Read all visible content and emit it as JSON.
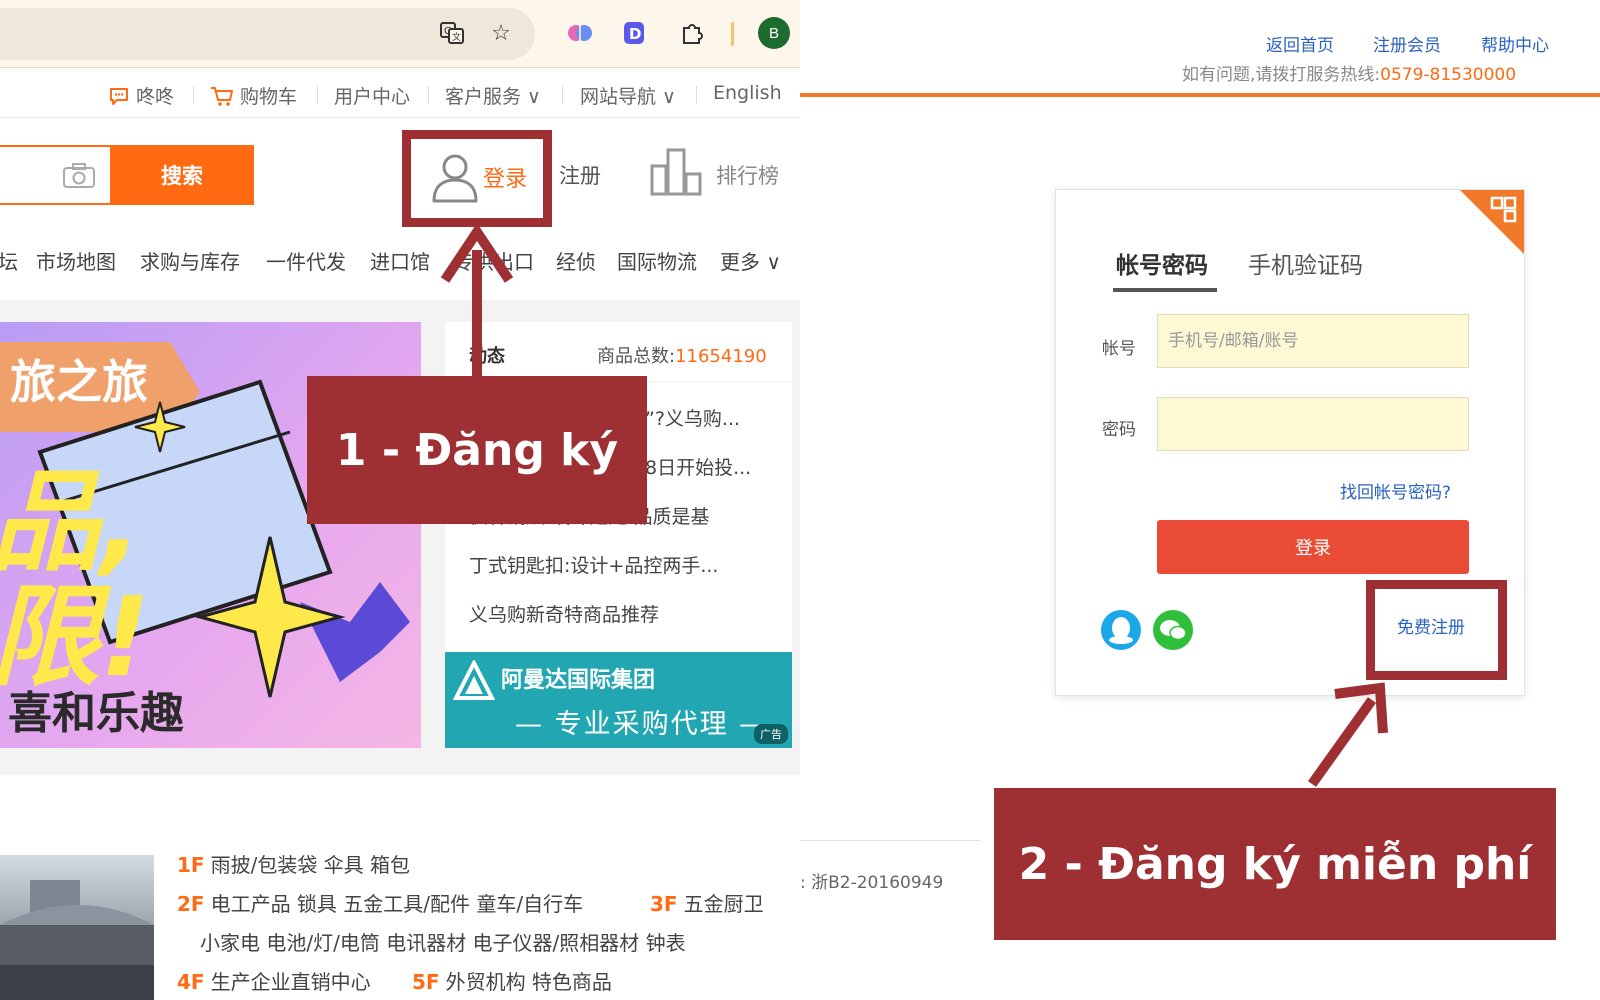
{
  "browser": {
    "avatar_letter": "B"
  },
  "topnav": {
    "items": [
      {
        "label": "咚咚",
        "icon": "chat-bubble-icon"
      },
      {
        "label": "购物车",
        "icon": "cart-icon"
      },
      {
        "label": "用户中心"
      },
      {
        "label": "客户服务 ∨"
      },
      {
        "label": "网站导航 ∨"
      },
      {
        "label": "English"
      }
    ]
  },
  "search": {
    "button_label": "搜索"
  },
  "header_links": {
    "login": "登录",
    "register": "注册",
    "ranking": "排行榜"
  },
  "catnav": {
    "items": [
      "坛",
      "市场地图",
      "求购与库存",
      "一件代发",
      "进口馆",
      "专供出口",
      "经侦",
      "国际物流",
      "更多 ∨"
    ]
  },
  "banner": {
    "line1": "旅之旅",
    "line2": "品,",
    "line3": "限!",
    "footer": "喜和乐趣"
  },
  "news": {
    "title": "动态",
    "goods_label": "商品总数:",
    "goods_count": "11654190",
    "items": [
      "”?义乌购...",
      "8日开始投...",
      "枫林铜烛:设计是定 品质是基",
      "丁式钥匙扣:设计+品控两手...",
      "义乌购新奇特商品推荐"
    ]
  },
  "ad": {
    "company": "阿曼达国际集团",
    "slogan": "— 专业采购代理 —",
    "tag": "广告"
  },
  "floors": {
    "rows": [
      {
        "items": [
          {
            "num": "1F",
            "text": "雨披/包装袋 伞具 箱包"
          }
        ]
      },
      {
        "items": [
          {
            "num": "2F",
            "text": "电工产品 锁具 五金工具/配件 童车/自行车"
          },
          {
            "num": "3F",
            "text": "五金厨卫"
          }
        ]
      },
      {
        "items": [
          {
            "num": "",
            "text": "小家电 电池/灯/电筒 电讯器材 电子仪器/照相器材 钟表"
          }
        ]
      },
      {
        "items": [
          {
            "num": "4F",
            "text": "生产企业直销中心"
          },
          {
            "num": "5F",
            "text": "外贸机构 特色商品"
          }
        ]
      }
    ]
  },
  "callout_1": "1 - Đăng ký",
  "callout_2": "2 - Đăng ký miễn phí",
  "right": {
    "links": [
      "返回首页",
      "注册会员",
      "帮助中心"
    ],
    "hotline_label": "如有问题,请拨打服务热线:",
    "hotline_number": "0579-81530000",
    "tabs": [
      "帐号密码",
      "手机验证码"
    ],
    "account_label": "帐号",
    "account_placeholder": "手机号/邮箱/账号",
    "password_label": "密码",
    "forgot": "找回帐号密码?",
    "submit": "登录",
    "free_register": "免费注册",
    "icp": ": 浙B2-20160949"
  },
  "colors": {
    "accent_orange": "#ff6a13",
    "callout_red": "#9e2f32",
    "link_blue": "#2b62c1",
    "submit_red": "#e94b36"
  }
}
